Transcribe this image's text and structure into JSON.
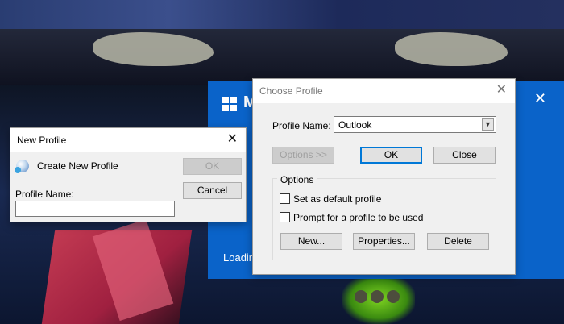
{
  "splash": {
    "brand": "M",
    "loading": "Loadin",
    "close_glyph": "✕"
  },
  "new_profile": {
    "title": "New Profile",
    "close_glyph": "✕",
    "heading": "Create New Profile",
    "profile_name_label": "Profile Name:",
    "profile_name_value": "",
    "ok_label": "OK",
    "cancel_label": "Cancel"
  },
  "choose_profile": {
    "title": "Choose Profile",
    "close_glyph": "✕",
    "profile_name_label": "Profile Name:",
    "profile_selected": "Outlook",
    "options_btn_label": "Options >>",
    "ok_label": "OK",
    "close_label": "Close",
    "options_group_title": "Options",
    "set_default_label": "Set as default profile",
    "set_default_checked": false,
    "prompt_label": "Prompt for a profile to be used",
    "prompt_checked": false,
    "new_label": "New...",
    "properties_label": "Properties...",
    "delete_label": "Delete"
  }
}
